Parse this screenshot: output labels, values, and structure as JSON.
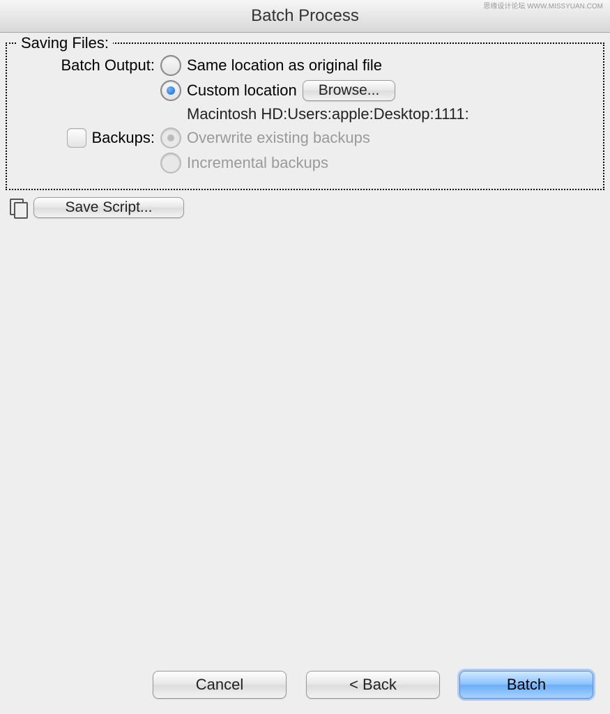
{
  "title": "Batch Process",
  "watermark": "思缘设计论坛 WWW.MISSYUAN.COM",
  "fieldset": {
    "legend": "Saving Files:",
    "batch_output_label": "Batch Output:",
    "option_same_location": "Same location as original file",
    "option_custom_location": "Custom location",
    "browse_button": "Browse...",
    "path_text": "Macintosh HD:Users:apple:Desktop:1111:",
    "backups_label": "Backups:",
    "option_overwrite": "Overwrite existing backups",
    "option_incremental": "Incremental backups"
  },
  "save_script_button": "Save Script...",
  "footer": {
    "cancel": "Cancel",
    "back": "< Back",
    "batch": "Batch"
  }
}
